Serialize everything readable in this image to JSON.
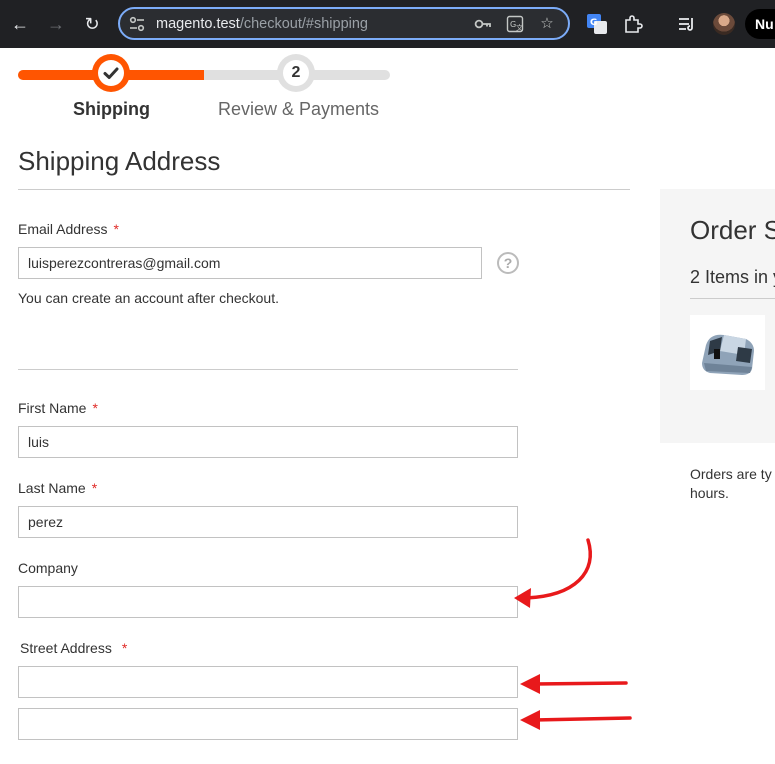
{
  "browser": {
    "url_host": "magento.test",
    "url_path": "/checkout/#shipping",
    "profile_label": "Nu"
  },
  "progress": {
    "steps": [
      {
        "number": "",
        "label": "Shipping",
        "state": "complete"
      },
      {
        "number": "2",
        "label": "Review & Payments",
        "state": "pending"
      }
    ],
    "progress_fraction": 0.5
  },
  "form": {
    "title": "Shipping Address",
    "required_marker": "*",
    "email": {
      "label": "Email Address",
      "value": "luisperezcontreras@gmail.com",
      "help": "?"
    },
    "account_note": "You can create an account after checkout.",
    "first_name": {
      "label": "First Name",
      "value": "luis"
    },
    "last_name": {
      "label": "Last Name",
      "value": "perez"
    },
    "company": {
      "label": "Company",
      "value": ""
    },
    "street": {
      "label": "Street Address",
      "line1": "",
      "line2": ""
    }
  },
  "summary": {
    "title": "Order S",
    "items_count": "2 Items in y",
    "note_line1": "Orders are ty",
    "note_line2": "hours."
  },
  "colors": {
    "accent": "#ff5501",
    "annotation": "#e8191b",
    "chrome_bg": "#202124",
    "omnibox_border": "#7cacf8"
  }
}
